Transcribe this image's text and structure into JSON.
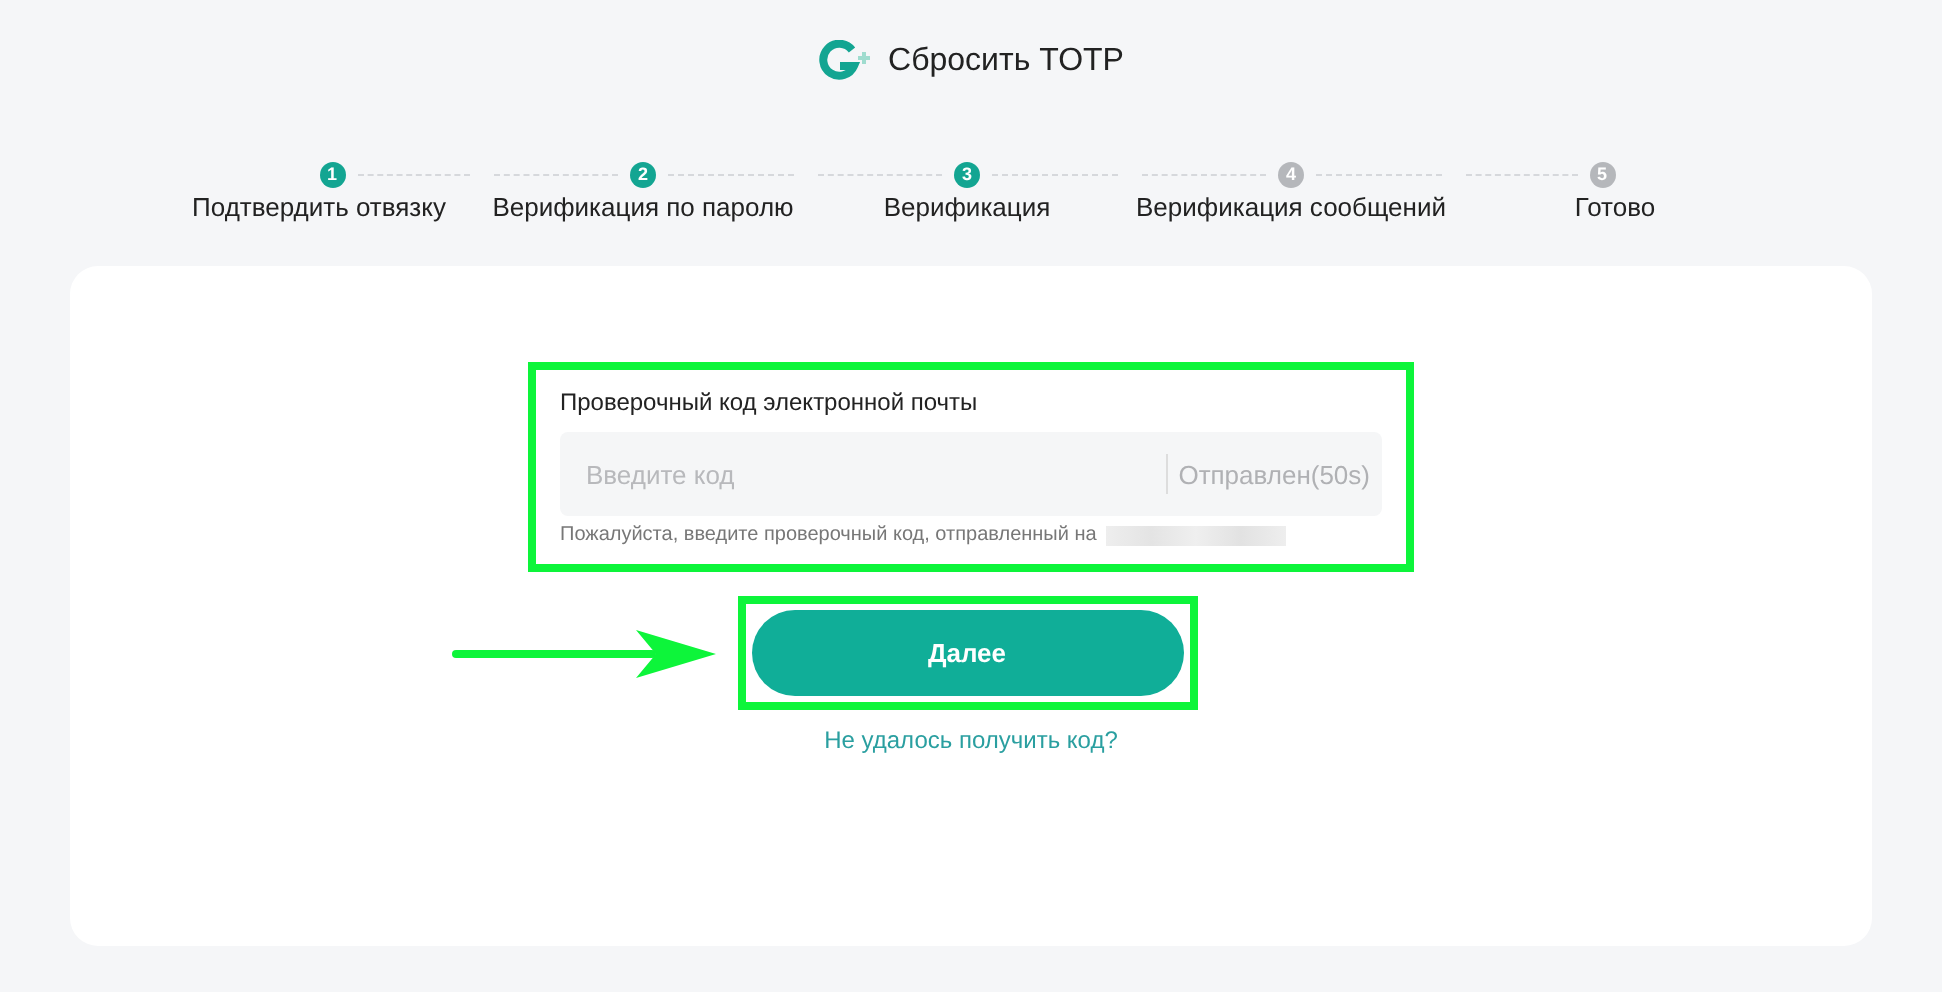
{
  "header": {
    "title": "Сбросить TOTP"
  },
  "steps": [
    {
      "number": "1",
      "label": "Подтвердить отвязку",
      "active": true
    },
    {
      "number": "2",
      "label": "Верификация по паролю",
      "active": true
    },
    {
      "number": "3",
      "label": "Верификация",
      "active": true
    },
    {
      "number": "4",
      "label": "Верификация сообщений",
      "active": false
    },
    {
      "number": "5",
      "label": "Готово",
      "active": false
    }
  ],
  "form": {
    "label": "Проверочный код электронной почты",
    "placeholder": "Введите код",
    "send_status": "Отправлен(50s)",
    "hint": "Пожалуйста, введите проверочный код, отправленный на",
    "highlighted": true
  },
  "next_button": {
    "label": "Далее",
    "highlighted": true
  },
  "help_link": "Не удалось получить код?",
  "annotation_arrow": true
}
